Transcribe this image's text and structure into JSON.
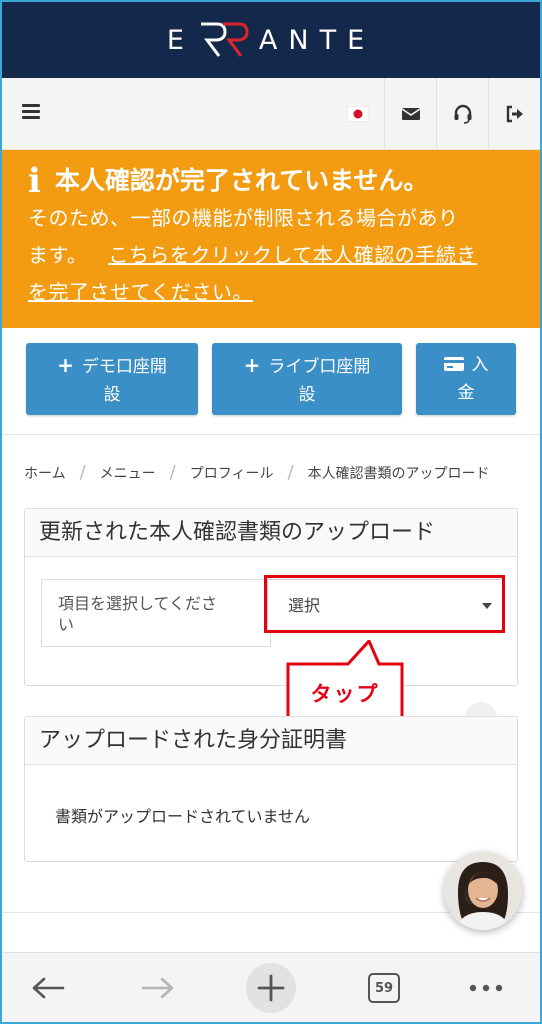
{
  "brand": {
    "logo_text": "ERRANTE",
    "logo_left": "E",
    "logo_right": "ANTE"
  },
  "alert": {
    "title": "本人確認が完了されていません。",
    "body_line1": "そのため、一部の機能が制限される場合があり",
    "body_line2_plain": "ます。",
    "link_part1": "こちらをクリックして本人確認の手続き",
    "link_part2": "を完了させてください。"
  },
  "actions": {
    "demo_line1": "デモ口座開",
    "demo_line2": "設",
    "live_line1": "ライブ口座開",
    "live_line2": "設",
    "deposit_line1": "入",
    "deposit_line2": "金"
  },
  "breadcrumb": [
    "ホーム",
    "メニュー",
    "プロフィール",
    "本人確認書類のアップロード"
  ],
  "upload_panel": {
    "title": "更新された本人確認書類のアップロード",
    "label_line1": "項目を選択してくださ",
    "label_line2": "い",
    "select_value": "選択"
  },
  "annotation": {
    "tap_label": "タップ"
  },
  "uploaded_panel": {
    "title": "アップロードされた身分証明書",
    "empty_message": "書類がアップロードされていません"
  },
  "browser": {
    "tab_count": "59"
  },
  "colors": {
    "brand": "#13284a",
    "logo_accent": "#e0242f",
    "alert": "#f39c12",
    "button": "#3a8fc6",
    "annotation": "#e60012"
  },
  "icons": [
    "menu-icon",
    "japan-flag-icon",
    "mail-icon",
    "headset-icon",
    "logout-icon",
    "info-icon",
    "credit-card-icon",
    "back-icon",
    "forward-icon",
    "new-tab-icon",
    "tabs-icon",
    "more-icon"
  ]
}
